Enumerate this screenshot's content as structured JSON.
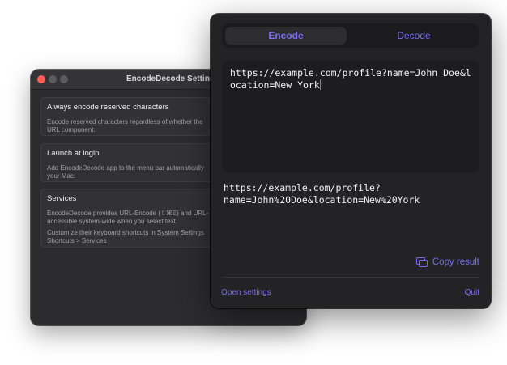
{
  "settings": {
    "window_title": "EncodeDecode Settings",
    "items": [
      {
        "title": "Always encode reserved characters",
        "desc": "Encode reserved characters regardless of whether the\nURL component."
      },
      {
        "title": "Launch at login",
        "desc": "Add EncodeDecode app to the menu bar automatically\nyour Mac."
      },
      {
        "title": "Services",
        "desc": "EncodeDecode provides URL-Encode (⇧⌘E) and URL-\naccessible system-wide when you select text.",
        "desc2": "Customize their keyboard shortcuts in System Settings\nShortcuts > Services"
      }
    ]
  },
  "popover": {
    "tabs": {
      "encode": "Encode",
      "decode": "Decode"
    },
    "input_value": "https://example.com/profile?name=John Doe&location=New York",
    "result": "https://example.com/profile?\nname=John%20Doe&location=New%20York",
    "copy_label": "Copy result",
    "open_settings": "Open settings",
    "quit": "Quit"
  },
  "colors": {
    "accent": "#7c6cf2",
    "background": "#232325",
    "close": "#ff5f57"
  }
}
